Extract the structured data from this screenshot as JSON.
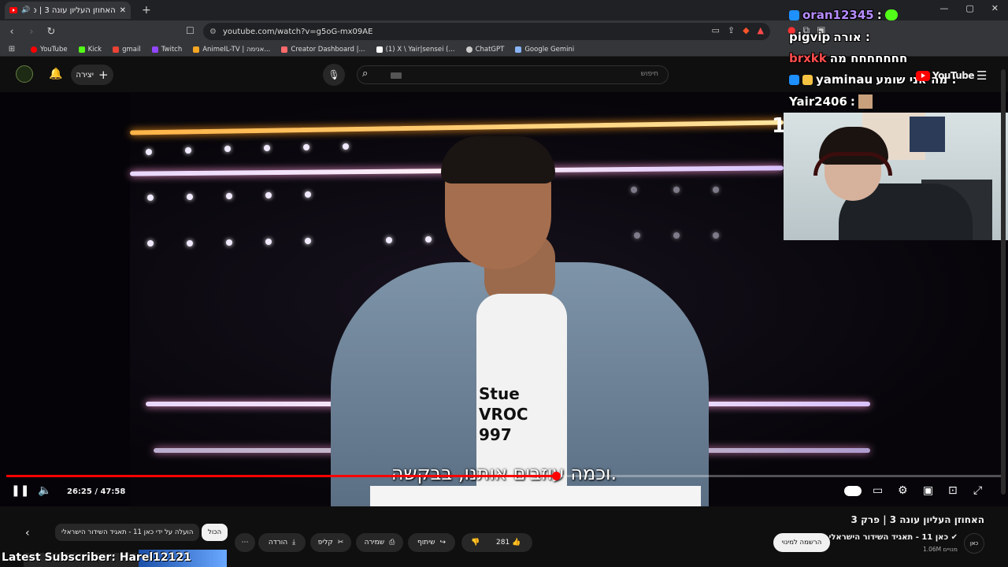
{
  "browser": {
    "tab_title": "האחוזן העליון עונה 3 | פרק 3",
    "url": "youtube.com/watch?v=g5oG-mx09AE",
    "bookmarks": [
      {
        "label": "YouTube",
        "color": "#ff0000"
      },
      {
        "label": "Kick",
        "color": "#53fc18"
      },
      {
        "label": "gmail",
        "color": "#ea4335"
      },
      {
        "label": "Twitch",
        "color": "#9146ff"
      },
      {
        "label": "AnimeIL-TV | אנימה...",
        "color": "#f5a623"
      },
      {
        "label": "Creator Dashboard |...",
        "color": "#ff6b6b"
      },
      {
        "label": "(1) X \\ Yair|sensei (...",
        "color": "#ffffff"
      },
      {
        "label": "ChatGPT",
        "color": "#cccccc"
      },
      {
        "label": "Google Gemini",
        "color": "#8ab4f8"
      }
    ]
  },
  "youtube_header": {
    "create_label": "יצירה",
    "search_placeholder": "חיפוש",
    "logo_text": "YouTube"
  },
  "player": {
    "subtitle": "וכמה עוזבים אותנו, בבקשה.",
    "shirt_text": [
      "Stue",
      "VROC",
      "997"
    ],
    "time_display": "26:25 / 47:58",
    "progress_fraction": 0.552,
    "corner_digits": "1"
  },
  "stream_chat": [
    {
      "user": "oran12345",
      "text": "",
      "user_color": "#b68cff",
      "badge": "#1e90ff"
    },
    {
      "user": "pigvip",
      "text": "אורה :",
      "user_color": "#ffffff",
      "badge": ""
    },
    {
      "user": "brxkk",
      "text": "חחחחחחח מה",
      "user_color": "#ff4d4d",
      "badge": ""
    },
    {
      "user": "yaminau",
      "text": "מה אני שומע :",
      "user_color": "#ffffff",
      "badge": "#1e90ff"
    },
    {
      "user": "Yair2406",
      "text": ":",
      "user_color": "#ffffff",
      "badge": ""
    }
  ],
  "video_info": {
    "title": "האחוזן העליון עונה 3 | פרק 3",
    "channel": "כאן 11 - תאגיד השידור הישראלי",
    "subscribers": "1.06M מנויים",
    "channel_avatar": "כאן",
    "subscribe_label": "הרשמה למינוי",
    "likes": "281",
    "share_label": "שיתוף",
    "save_label": "שמירה",
    "clip_label": "קליפ",
    "download_label": "הורדה",
    "chip_all": "הכול",
    "chip_uploaded": "הועלה על ידי כאן 11 - תאגיד השידור הישראלי"
  },
  "overlay": {
    "latest_subscriber": "Latest Subscriber: Harel12121"
  }
}
